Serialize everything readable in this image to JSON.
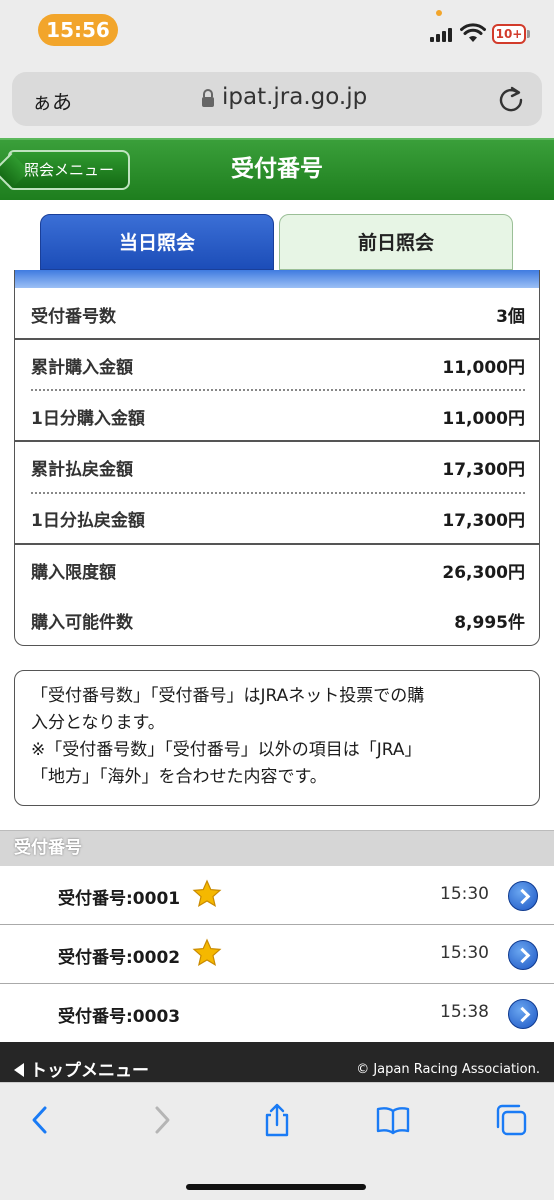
{
  "status_bar": {
    "time": "15:56",
    "battery": "10+"
  },
  "browser": {
    "text_size_button": "ぁあ",
    "url": "ipat.jra.go.jp"
  },
  "header": {
    "back_label": "照会メニュー",
    "title": "受付番号",
    "color": "#2a8c2a"
  },
  "tabs": [
    {
      "label": "当日照会",
      "active": true
    },
    {
      "label": "前日照会",
      "active": false
    }
  ],
  "summary": {
    "rows": [
      {
        "label": "受付番号数",
        "value": "3個"
      },
      {
        "label": "累計購入金額",
        "value": "11,000円"
      },
      {
        "label": "1日分購入金額",
        "value": "11,000円"
      },
      {
        "label": "累計払戻金額",
        "value": "17,300円"
      },
      {
        "label": "1日分払戻金額",
        "value": "17,300円"
      },
      {
        "label": "購入限度額",
        "value": "26,300円"
      },
      {
        "label": "購入可能件数",
        "value": "8,995件"
      }
    ]
  },
  "notice": {
    "line1": "「受付番号数」「受付番号」はJRAネット投票での購",
    "line2": "入分となります。",
    "line3": "※「受付番号数」「受付番号」以外の項目は「JRA」",
    "line4": "「地方」「海外」を合わせた内容です。"
  },
  "receipts": {
    "section_title": "受付番号",
    "items": [
      {
        "label": "受付番号:0001",
        "time": "15:30",
        "starred": true
      },
      {
        "label": "受付番号:0002",
        "time": "15:30",
        "starred": true
      },
      {
        "label": "受付番号:0003",
        "time": "15:38",
        "starred": false
      }
    ]
  },
  "footer": {
    "top_menu": "トップメニュー",
    "copyright": "© Japan Racing Association."
  },
  "toolbar": {
    "icons": [
      "back-arrow-icon",
      "forward-arrow-icon",
      "share-icon",
      "bookmarks-icon",
      "tabs-icon"
    ]
  },
  "colors": {
    "accent_blue": "#1c4db8",
    "star": "#f5b800",
    "link_blue": "#1a7bf5"
  }
}
